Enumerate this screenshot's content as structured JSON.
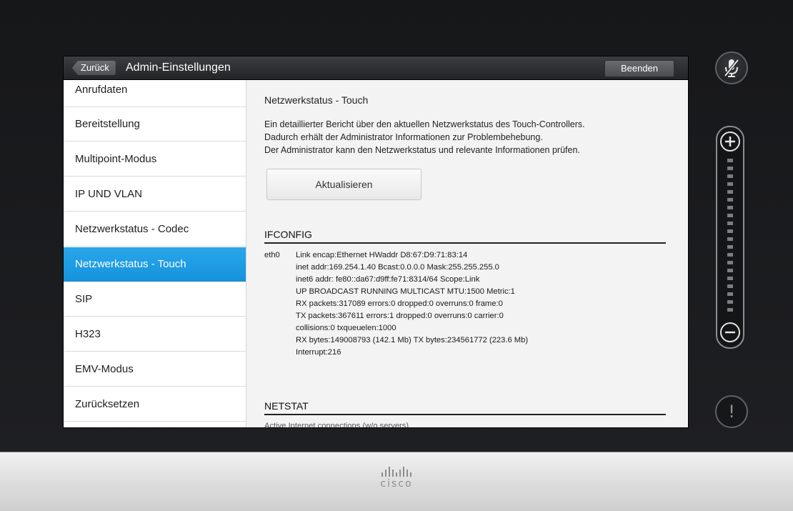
{
  "header": {
    "back_label": "Zurück",
    "title": "Admin-Einstellungen",
    "end_label": "Beenden"
  },
  "sidebar": {
    "items": [
      {
        "label": "Anrufdaten"
      },
      {
        "label": "Bereitstellung"
      },
      {
        "label": "Multipoint-Modus"
      },
      {
        "label": "IP UND VLAN"
      },
      {
        "label": "Netzwerkstatus - Codec"
      },
      {
        "label": "Netzwerkstatus - Touch",
        "active": true
      },
      {
        "label": "SIP"
      },
      {
        "label": "H323"
      },
      {
        "label": "EMV-Modus"
      },
      {
        "label": "Zurücksetzen"
      }
    ]
  },
  "content": {
    "heading": "Netzwerkstatus - Touch",
    "description": [
      "Ein detaillierter Bericht über den aktuellen Netzwerkstatus des Touch-Controllers.",
      "Dadurch erhält der Administrator Informationen zur Problembehebung.",
      "Der Administrator kann den Netzwerkstatus und relevante Informationen prüfen."
    ],
    "refresh_label": "Aktualisieren",
    "ifconfig": {
      "heading": "IFCONFIG",
      "interface": "eth0",
      "lines": [
        "Link encap:Ethernet  HWaddr D8:67:D9:71:83:14",
        "inet addr:169.254.1.40  Bcast:0.0.0.0  Mask:255.255.255.0",
        "inet6 addr: fe80::da67:d9ff:fe71:8314/64 Scope:Link",
        "UP BROADCAST RUNNING MULTICAST  MTU:1500  Metric:1",
        "RX packets:317089 errors:0 dropped:0 overruns:0 frame:0",
        "TX packets:367611 errors:1 dropped:0 overruns:0 carrier:0",
        "collisions:0 txqueuelen:1000",
        "RX bytes:149008793 (142.1 Mb)  TX bytes:234561772 (223.6 Mb)",
        "Interrupt:216"
      ]
    },
    "netstat": {
      "heading": "NETSTAT",
      "first_line": "Active Internet connections (w/o servers)"
    }
  },
  "controls": {
    "mute_icon": "microphone-muted-icon",
    "volume_plus": "+",
    "volume_minus": "−",
    "alert_symbol": "!"
  },
  "brand": {
    "name": "cisco"
  },
  "colors": {
    "accent": "#1b9be3",
    "titlebar": "#2d2e31",
    "background": "#1a1b1d"
  }
}
